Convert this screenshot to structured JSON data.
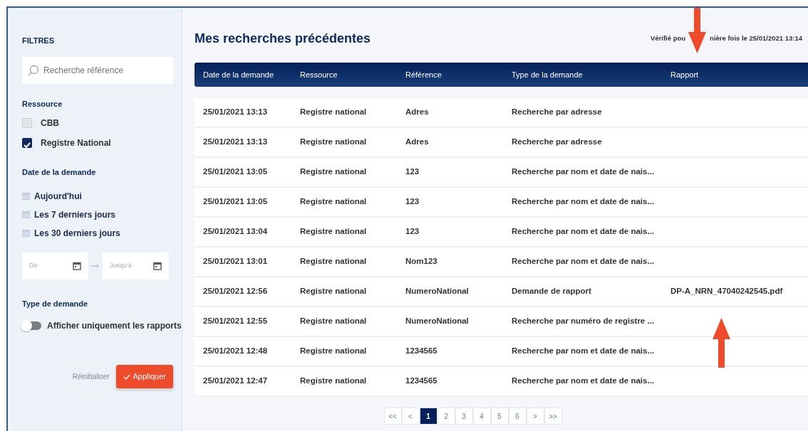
{
  "sidebar": {
    "title": "FILTRES",
    "search": {
      "placeholder": "Recherche référence"
    },
    "resource": {
      "heading": "Ressource",
      "options": [
        {
          "label": "CBB",
          "checked": false
        },
        {
          "label": "Registre National",
          "checked": true
        }
      ]
    },
    "date": {
      "heading": "Date de la demande",
      "presets": [
        "Aujourd'hui",
        "Les 7 derniers jours",
        "Les 30 derniers jours"
      ],
      "from": {
        "placeholder": "De"
      },
      "to": {
        "placeholder": "Jusqu'à"
      }
    },
    "type": {
      "heading": "Type de demande",
      "toggle": {
        "label": "Afficher uniquement les rapports",
        "on": false
      }
    },
    "reset": "Réinitialiser",
    "apply": "Appliquer"
  },
  "main": {
    "title": "Mes recherches précédentes",
    "verified_parts": [
      "Vérifié pou",
      "nière fois le 25/01/2021 13:14"
    ],
    "table": {
      "columns": [
        "Date de la demande",
        "Ressource",
        "Référence",
        "Type de la demande",
        "Rapport"
      ],
      "rows": [
        [
          "25/01/2021 13:13",
          "Registre national",
          "Adres",
          "Recherche par adresse",
          ""
        ],
        [
          "25/01/2021 13:13",
          "Registre national",
          "Adres",
          "Recherche par adresse",
          ""
        ],
        [
          "25/01/2021 13:05",
          "Registre national",
          "123",
          "Recherche par nom et date de nais...",
          ""
        ],
        [
          "25/01/2021 13:05",
          "Registre national",
          "123",
          "Recherche par nom et date de nais...",
          ""
        ],
        [
          "25/01/2021 13:04",
          "Registre national",
          "123",
          "Recherche par nom et date de nais...",
          ""
        ],
        [
          "25/01/2021 13:01",
          "Registre national",
          "Nom123",
          "Recherche par nom et date de nais...",
          ""
        ],
        [
          "25/01/2021 12:56",
          "Registre national",
          "NumeroNational",
          "Demande de rapport",
          "DP-A_NRN_47040242545.pdf"
        ],
        [
          "25/01/2021 12:55",
          "Registre national",
          "NumeroNational",
          "Recherche par numéro de registre ...",
          ""
        ],
        [
          "25/01/2021 12:48",
          "Registre national",
          "1234565",
          "Recherche par nom et date de nais...",
          ""
        ],
        [
          "25/01/2021 12:47",
          "Registre national",
          "1234565",
          "Recherche par nom et date de nais...",
          ""
        ]
      ]
    },
    "pagination": [
      {
        "label": "<<",
        "selected": false
      },
      {
        "label": "<",
        "selected": false
      },
      {
        "label": "1",
        "selected": true
      },
      {
        "label": "2",
        "selected": false
      },
      {
        "label": "3",
        "selected": false
      },
      {
        "label": "4",
        "selected": false
      },
      {
        "label": "5",
        "selected": false
      },
      {
        "label": "6",
        "selected": false
      },
      {
        "label": ">",
        "selected": false
      },
      {
        "label": ">>",
        "selected": false
      }
    ]
  },
  "annotations": [
    {
      "kind": "down"
    },
    {
      "kind": "up"
    }
  ]
}
